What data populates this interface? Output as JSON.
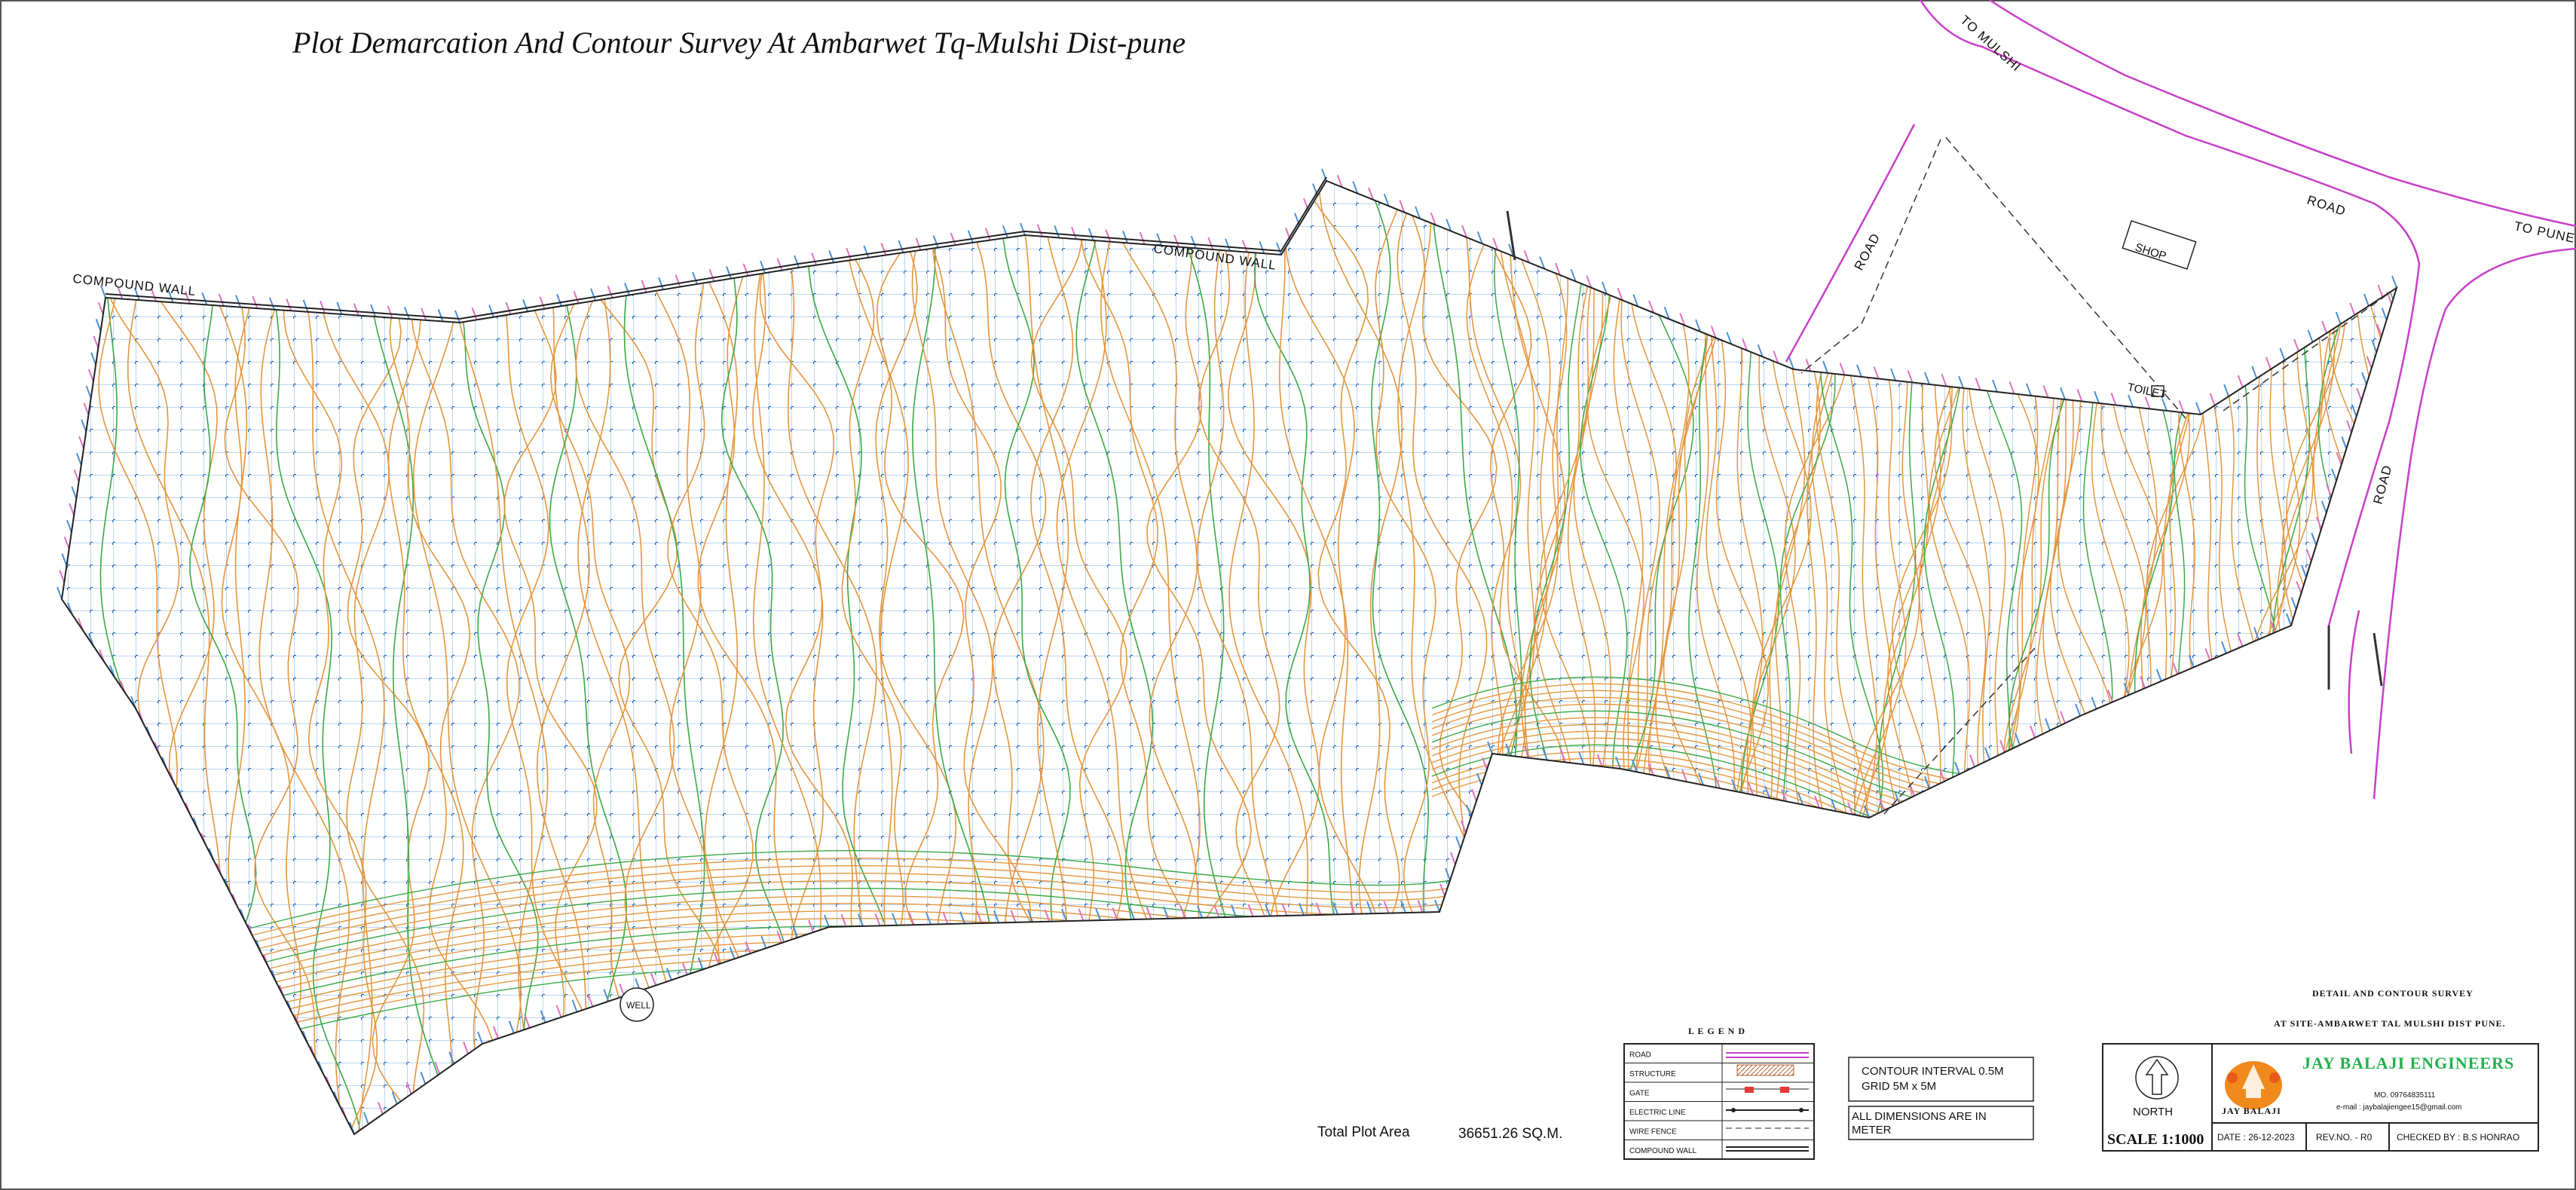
{
  "title": "Plot  Demarcation And Contour Survey At Ambarwet Tq-Mulshi Dist-pune",
  "labels": {
    "to_mulshi": "TO MULSHI",
    "to_pune": "TO PUNE",
    "road": "ROAD",
    "compound_wall": "COMPOUND WALL",
    "shop": "SHOP",
    "toilet": "TOILET",
    "well": "WELL"
  },
  "legend": {
    "title": "L E G E N D",
    "items": [
      "ROAD",
      "STRUCTURE",
      "GATE",
      "ELECTRIC  LINE",
      "WIRE  FENCE",
      "COMPOUND  WALL"
    ]
  },
  "notes": {
    "contour_interval": "CONTOUR INTERVAL 0.5M",
    "grid": "GRID 5M x 5M",
    "dimensions_line1": "ALL DIMENSIONS ARE IN",
    "dimensions_line2": "METER"
  },
  "total_area": {
    "label": "Total Plot Area",
    "value": "36651.26 SQ.M."
  },
  "title_block": {
    "heading1": "DETAIL AND CONTOUR SURVEY",
    "heading2": "AT SITE-AMBARWET TAL MULSHI DIST PUNE.",
    "north": "NORTH",
    "scale": "SCALE  1:1000",
    "firm": "JAY BALAJI ENGINEERS",
    "logo_text": "JAY  BALAJI",
    "mobile": "MO.  09764835111",
    "email": "e-mail  :  jaybalajiengee15@gmail.com",
    "date": "DATE : 26-12-2023",
    "rev": "REV.NO. - R0",
    "checked": "CHECKED  BY : B.S HONRAO"
  },
  "colors": {
    "contour": "#e3963e",
    "index_contour": "#3aa845",
    "grid": "#4a8fd0",
    "road": "#c83fc8",
    "boundary": "#222222",
    "spot_level": "#e070c0",
    "firm": "#22b14c",
    "logo": "#f08a1c"
  },
  "icons": {
    "north_arrow": "north-arrow-icon",
    "logo": "temple-logo-icon",
    "well": "well-symbol-icon"
  }
}
